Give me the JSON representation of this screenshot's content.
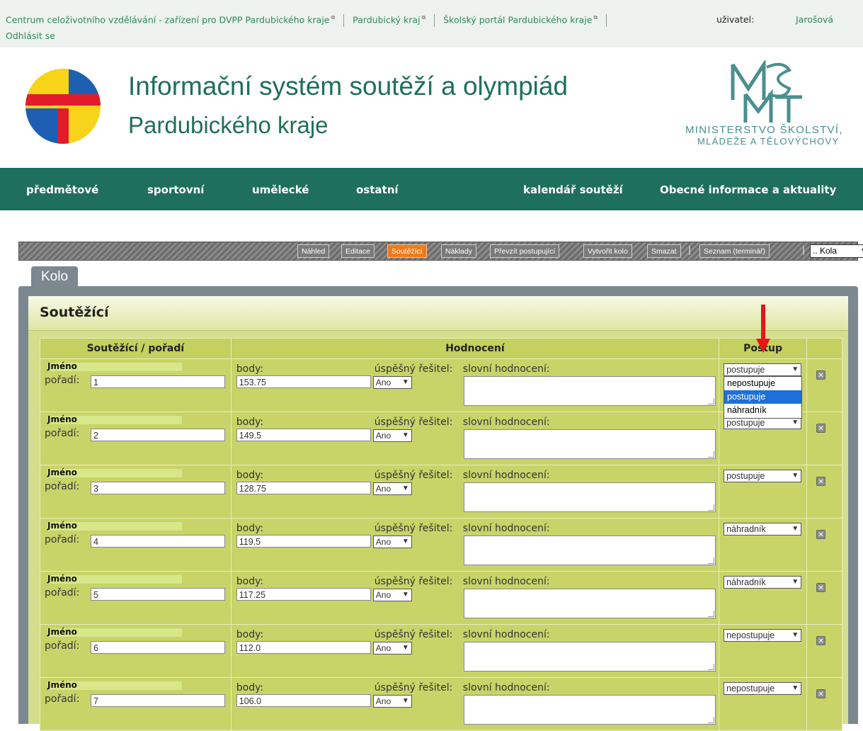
{
  "topbar": {
    "link1": "Centrum celoživotního vzdělávání - zařízení pro DVPP Pardubického kraje",
    "link2": "Pardubický kraj",
    "link3": "Školský portál Pardubického kraje",
    "user_label": "uživatel:",
    "user_name": "Jarošová",
    "logout": "Odhlásit se"
  },
  "header": {
    "title_line1": "Informační systém soutěží a olympiád",
    "title_line2": "Pardubického kraje",
    "ministry_line1": "MINISTERSTVO ŠKOLSTVÍ,",
    "ministry_line2": "MLÁDEŽE A TĚLOVÝCHOVY"
  },
  "nav": {
    "items": [
      "předmětové",
      "sportovní",
      "umělecké",
      "ostatní",
      "kalendář soutěží",
      "Obecné informace a aktuality"
    ]
  },
  "toolbar": {
    "buttons": [
      "Náhled",
      "Editace",
      "Soutěžící",
      "Náklady",
      "Převzít postupující",
      "Vytvořit kolo",
      "Smazat",
      "Seznam (terminář)"
    ],
    "active": "Soutěžící",
    "kola_select": ".. Kola"
  },
  "tab": "Kolo",
  "panel_title": "Soutěžící",
  "table": {
    "headers": [
      "Soutěžící / pořadí",
      "Hodnocení",
      "Postup"
    ],
    "labels": {
      "name": "Jméno",
      "rank": "pořadí:",
      "points": "body:",
      "successful": "úspěšný řešitel:",
      "verbal": "slovní hodnocení:"
    },
    "rows": [
      {
        "rank": "1",
        "points": "153.75",
        "successful": "Ano",
        "advance": "postupuje"
      },
      {
        "rank": "2",
        "points": "149.5",
        "successful": "Ano",
        "advance": "postupuje"
      },
      {
        "rank": "3",
        "points": "128.75",
        "successful": "Ano",
        "advance": "postupuje"
      },
      {
        "rank": "4",
        "points": "119.5",
        "successful": "Ano",
        "advance": "náhradník"
      },
      {
        "rank": "5",
        "points": "117.25",
        "successful": "Ano",
        "advance": "náhradník"
      },
      {
        "rank": "6",
        "points": "112.0",
        "successful": "Ano",
        "advance": "nepostupuje"
      },
      {
        "rank": "7",
        "points": "106.0",
        "successful": "Ano",
        "advance": "nepostupuje"
      }
    ]
  },
  "dropdown": {
    "options": [
      "nepostupuje",
      "postupuje",
      "náhradník"
    ],
    "highlighted": "postupuje"
  },
  "colors": {
    "nav": "#1e6f5c",
    "title": "#1f6f5a",
    "active_button": "#f07a1a",
    "table_bg": "#c8d468",
    "annotation_arrow": "#e8141c"
  }
}
